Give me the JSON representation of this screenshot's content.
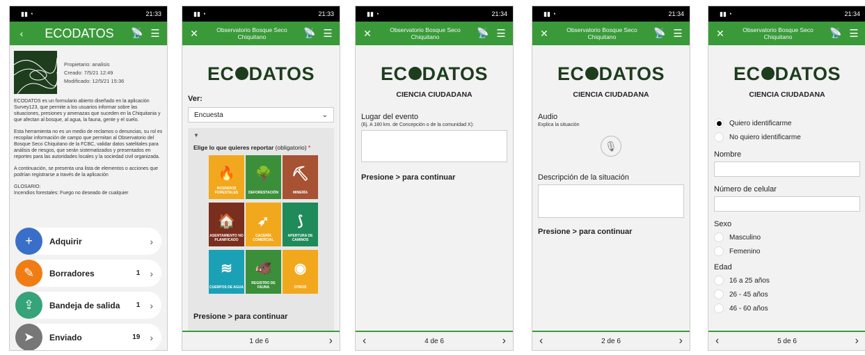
{
  "phones": [
    {
      "time": "21:33",
      "title": "ECODATOS"
    },
    {
      "time": "21:33",
      "title": "Observatorio Bosque Seco Chiquitano"
    },
    {
      "time": "21:34",
      "title": "Observatorio Bosque Seco Chiquitano"
    },
    {
      "time": "21:34",
      "title": "Observatorio Bosque Seco Chiquitano"
    },
    {
      "time": "21:34",
      "title": "Observatorio Bosque Seco Chiquitano"
    }
  ],
  "p1": {
    "owner": "Propietario: analisis",
    "created": "Creado: 7/5/21 12:49",
    "modified": "Modificado: 12/5/21 15:36",
    "para1": "ECODATOS es un formulario abierto diseñado en la aplicación Survey123, que permite a los usuarios informar sobre las situaciones, presiones y amenazas que suceden en la Chiquitania y que afectan al bosque, al agua, la fauna, gente y el suelo.",
    "para2": "Esta herramienta no es un medio de reclamos o denuncias, su rol es recopilar información de campo que permitan al Observatorio del Bosque Seco Chiquitano de la FCBC, validar datos satelitales para análisis de riesgos, que serán sistematizados y presentados en reportes para las autoridades locales y la sociedad civil organizada.",
    "para3": "A continuación, se presenta una lista de elementos o acciones que podrían registrarse a través de la aplicación",
    "para4": "GLOSARIO:",
    "para5": "Incendios forestales: Fuego no deseado de cualquier",
    "actions": [
      {
        "label": "Adquirir",
        "count": "",
        "color": "#3a6fc9",
        "icon": "+"
      },
      {
        "label": "Borradores",
        "count": "1",
        "color": "#f07d14",
        "icon": "✎"
      },
      {
        "label": "Bandeja de salida",
        "count": "1",
        "color": "#37a37a",
        "icon": "⇪"
      },
      {
        "label": "Enviado",
        "count": "19",
        "color": "#777777",
        "icon": "➤"
      }
    ]
  },
  "logo": {
    "a": "EC",
    "b": "DATOS"
  },
  "cc": "CIENCIA CIUDADANA",
  "p2": {
    "ver": "Ver:",
    "select": "Encuesta",
    "elige": "Elige lo que quieres reportar",
    "oblig": "(obligatorio)",
    "tiles": [
      {
        "label": "INCENDIOS FORESTALES",
        "color": "#f2a81d",
        "glyph": "🔥"
      },
      {
        "label": "DEFORESTACIÓN",
        "color": "#3b8f3a",
        "glyph": "🌳"
      },
      {
        "label": "MINERÍA",
        "color": "#a65233",
        "glyph": "⛏"
      },
      {
        "label": "ASENTAMIENTO NO PLANIFICADO",
        "color": "#7a2e1e",
        "glyph": "🏠"
      },
      {
        "label": "CACERÍA COMERCIAL",
        "color": "#f2a81d",
        "glyph": "➶"
      },
      {
        "label": "APERTURA DE CAMINOS",
        "color": "#1f8a5a",
        "glyph": "⟆"
      },
      {
        "label": "CUERPOS DE AGUA",
        "color": "#1ba1b5",
        "glyph": "≋"
      },
      {
        "label": "REGISTRO DE FAUNA",
        "color": "#3b8f3a",
        "glyph": "🐗"
      },
      {
        "label": "OTROS",
        "color": "#f2a81d",
        "glyph": "◉"
      }
    ],
    "cont": "Presione > para continuar",
    "page": "1 de 6"
  },
  "p3": {
    "label": "Lugar del evento",
    "hint": "(Ej. A 180 km. de Concepción o de la comunidad X):",
    "cont": "Presione > para continuar",
    "page": "4 de 6"
  },
  "p4": {
    "audio": "Audio",
    "explain": "Explica la situación",
    "desc": "Descripción de la situación",
    "cont": "Presione > para continuar",
    "page": "2 de 6"
  },
  "p5": {
    "r1": "Quiero identificarme",
    "r2": "No quiero identificarme",
    "nombre": "Nombre",
    "cel": "Número de celular",
    "sexo": "Sexo",
    "m": "Masculino",
    "f": "Femenino",
    "edad": "Edad",
    "e1": "16 a 25 años",
    "e2": "26 - 45 años",
    "e3": "46 - 60 años",
    "page": "5 de 6"
  }
}
